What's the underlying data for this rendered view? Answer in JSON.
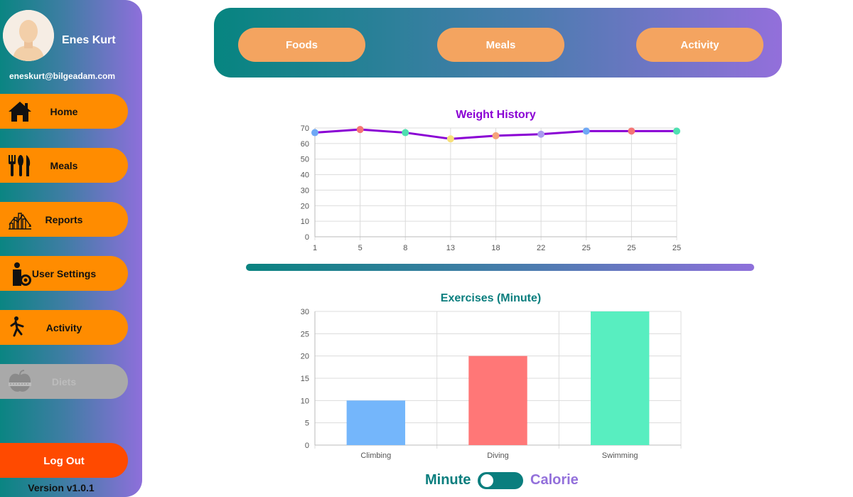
{
  "user": {
    "name": "Enes Kurt",
    "email": "eneskurt@bilgeadam.com"
  },
  "sidebar": {
    "items": [
      {
        "label": "Home",
        "icon": "home-icon",
        "enabled": true
      },
      {
        "label": "Meals",
        "icon": "utensils-icon",
        "enabled": true
      },
      {
        "label": "Reports",
        "icon": "reports-chart-icon",
        "enabled": true
      },
      {
        "label": "User Settings",
        "icon": "user-settings-icon",
        "enabled": true
      },
      {
        "label": "Activity",
        "icon": "running-person-icon",
        "enabled": true
      },
      {
        "label": "Diets",
        "icon": "apple-diet-icon",
        "enabled": false
      }
    ],
    "logout_label": "Log Out",
    "version": "Version v1.0.1"
  },
  "tabs": [
    {
      "label": "Foods"
    },
    {
      "label": "Meals"
    },
    {
      "label": "Activity"
    }
  ],
  "toggle": {
    "left_label": "Minute",
    "right_label": "Calorie",
    "selected": "Minute"
  },
  "colors": {
    "nav_item": "#ff8c00",
    "nav_disabled": "#a9a9a9",
    "logout": "#ff4a00",
    "tab_button": "#f4a460",
    "weight_line": "#8a00d4",
    "teal": "#0a7e7e",
    "purple": "#9370db"
  },
  "chart_data": [
    {
      "type": "line",
      "title": "Weight History",
      "categories": [
        "1",
        "5",
        "8",
        "13",
        "18",
        "22",
        "25",
        "25",
        "25"
      ],
      "series": [
        {
          "values": [
            67,
            69,
            67,
            63,
            65,
            66,
            68,
            68,
            68
          ]
        }
      ],
      "point_colors": [
        "#6fa8f5",
        "#f57575",
        "#4fe0b0",
        "#f7e07a",
        "#f5a37a",
        "#a99bf0",
        "#6fa8f5",
        "#f57575",
        "#4fe0b0"
      ],
      "yticks": [
        0,
        10,
        20,
        30,
        40,
        50,
        60,
        70
      ],
      "ylim": [
        0,
        70
      ],
      "grid": true
    },
    {
      "type": "bar",
      "title": "Exercises (Minute)",
      "categories": [
        "Climbing",
        "Diving",
        "Swimming"
      ],
      "values": [
        10,
        20,
        30
      ],
      "bar_colors": [
        "#74b6fb",
        "#ff7777",
        "#58eec0"
      ],
      "yticks": [
        0,
        5,
        10,
        15,
        20,
        25,
        30
      ],
      "ylim": [
        0,
        30
      ],
      "grid": true
    }
  ]
}
